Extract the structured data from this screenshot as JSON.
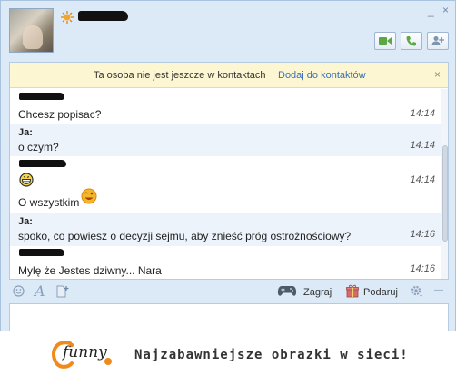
{
  "header": {
    "minimize_glyph": "_",
    "close_glyph": "×",
    "icons": [
      "avatar",
      "sun-status-icon",
      "video-icon",
      "phone-icon",
      "add-contact-icon"
    ]
  },
  "notice": {
    "text": "Ta osoba nie jest jeszcze w kontaktach",
    "link": "Dodaj do kontaktów",
    "close": "×"
  },
  "messages": [
    {
      "sender": "",
      "text": "Chcesz popisac?",
      "time": "14:14"
    },
    {
      "sender": "Ja:",
      "text": "o czym?",
      "time": "14:14"
    },
    {
      "sender": "",
      "text": "",
      "emoticon": "grin",
      "time": "14:14"
    },
    {
      "sender": "",
      "text": "O wszystkim",
      "emoticon": "wink",
      "time": ""
    },
    {
      "sender": "Ja:",
      "text": "spoko, co powiesz o decyzji sejmu, aby znieść próg ostrożnościowy?",
      "time": "14:16"
    },
    {
      "sender": "",
      "text": "Mylę że Jestes dziwny... Nara",
      "time": "14:16"
    }
  ],
  "toolbar": {
    "game_label": "Zagraj",
    "gift_label": "Podaruj",
    "collapse_glyph": "—"
  },
  "colors": {
    "window_bg": "#dce9f7",
    "notice_bg": "#fdf6d2",
    "link": "#3a6fb7",
    "logo_orange": "#f08a1a"
  },
  "footer": {
    "logo": "funny",
    "tagline": "Najzabawniejsze obrazki w sieci!"
  }
}
